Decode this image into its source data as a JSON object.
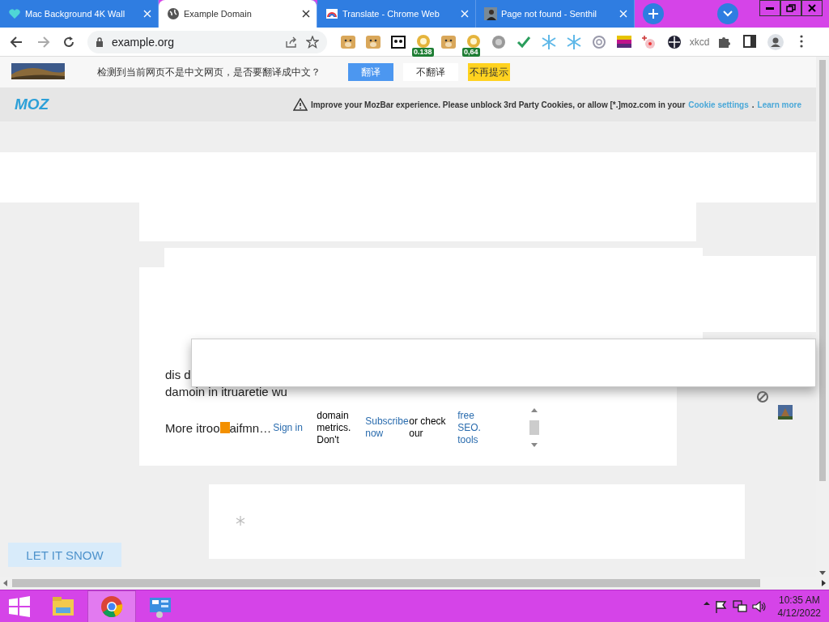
{
  "tabs": [
    {
      "title": "Mac Background 4K Wall",
      "kind": "heart",
      "selected": false
    },
    {
      "title": "Example Domain",
      "kind": "globe",
      "selected": true
    },
    {
      "title": "Translate - Chrome Web",
      "kind": "rainbow",
      "selected": false
    },
    {
      "title": "Page not found - Senthil",
      "selected": false
    }
  ],
  "address": "example.org",
  "extensions": [
    {
      "kind": "dog"
    },
    {
      "kind": "dog"
    },
    {
      "kind": "panda"
    },
    {
      "kind": "coin",
      "badge": "0.138"
    },
    {
      "kind": "dog"
    },
    {
      "kind": "coin",
      "badge": "0,64"
    },
    {
      "kind": "disc"
    },
    {
      "kind": "check"
    },
    {
      "kind": "snowflake"
    },
    {
      "kind": "snowflake"
    },
    {
      "kind": "flower"
    },
    {
      "kind": "stripes"
    },
    {
      "kind": "sparkle"
    },
    {
      "kind": "crosshair"
    },
    {
      "kind": "text",
      "label": "xkcd"
    },
    {
      "kind": "puzzle"
    }
  ],
  "translate_bar": {
    "message": "检测到当前网页不是中文网页，是否要翻译成中文？",
    "buttons": [
      {
        "label": "翻译",
        "kind": "primary"
      },
      {
        "label": "不翻译",
        "kind": "plain"
      },
      {
        "label": "不再提示",
        "kind": "highlight"
      }
    ]
  },
  "mozbar": {
    "logo": "MOZ",
    "notice": "Improve your MozBar experience. Please unblock 3rd Party Cookies, or allow [*.]moz.com in your",
    "links": [
      {
        "label": "Cookie settings",
        "after": "."
      },
      {
        "label": "Learn more"
      }
    ]
  },
  "page": {
    "lines": [
      "dis d",
      "damoin in itruaretie wu"
    ],
    "more_before": "More itroo",
    "more_after": "aifmn…",
    "mozbar_columns": [
      {
        "text": "Sign in",
        "link": true
      },
      {
        "text": "domain metrics. Don't",
        "link": false
      },
      {
        "text": "Subscribe now",
        "link": true
      },
      {
        "text": "or check our",
        "link": false
      },
      {
        "text": "free SEO. tools",
        "link": true
      }
    ],
    "snow_button": "LET IT SNOW"
  },
  "taskbar": {
    "apps": [
      {
        "kind": "files",
        "selected": false
      },
      {
        "kind": "chrome",
        "selected": true
      },
      {
        "kind": "control-panel",
        "selected": false
      }
    ],
    "time": "10:35 AM",
    "date": "4/12/2022"
  }
}
